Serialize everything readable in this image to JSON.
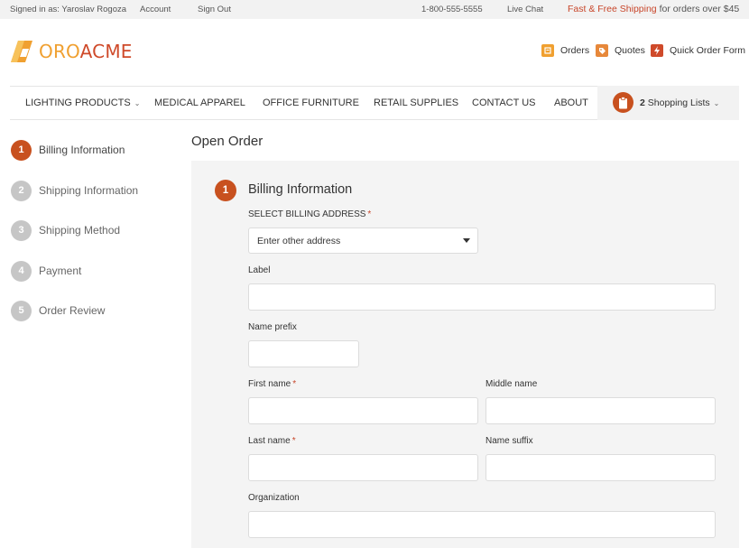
{
  "topbar": {
    "signed_in": "Signed in as: Yaroslav Rogoza",
    "account": "Account",
    "sign_out": "Sign Out",
    "phone": "1-800-555-5555",
    "live_chat": "Live Chat",
    "shipping_highlight": "Fast & Free Shipping",
    "shipping_rest": "for orders over $45"
  },
  "header": {
    "logo_oro": "ORO",
    "logo_acme": "ACME",
    "orders": "Orders",
    "quotes": "Quotes",
    "quick_order": "Quick Order Form"
  },
  "nav": {
    "items": [
      "LIGHTING PRODUCTS",
      "MEDICAL APPAREL",
      "OFFICE FURNITURE",
      "RETAIL SUPPLIES",
      "CONTACT US",
      "ABOUT"
    ],
    "shopping_count": "2",
    "shopping_label": "Shopping Lists"
  },
  "steps": [
    {
      "num": "1",
      "label": "Billing Information"
    },
    {
      "num": "2",
      "label": "Shipping Information"
    },
    {
      "num": "3",
      "label": "Shipping Method"
    },
    {
      "num": "4",
      "label": "Payment"
    },
    {
      "num": "5",
      "label": "Order Review"
    }
  ],
  "main": {
    "title": "Open Order",
    "section_num": "1",
    "section_title": "Billing Information",
    "select_address_label": "SELECT BILLING ADDRESS",
    "select_address_value": "Enter other address",
    "required_mark": "*",
    "fields": {
      "label": "Label",
      "name_prefix": "Name prefix",
      "first_name": "First name",
      "middle_name": "Middle name",
      "last_name": "Last name",
      "name_suffix": "Name suffix",
      "organization": "Organization"
    }
  },
  "colors": {
    "accent": "#c8511f",
    "logo_oro": "#f0a030",
    "logo_acme": "#cf4a2a",
    "panel_bg": "#f4f4f4"
  }
}
